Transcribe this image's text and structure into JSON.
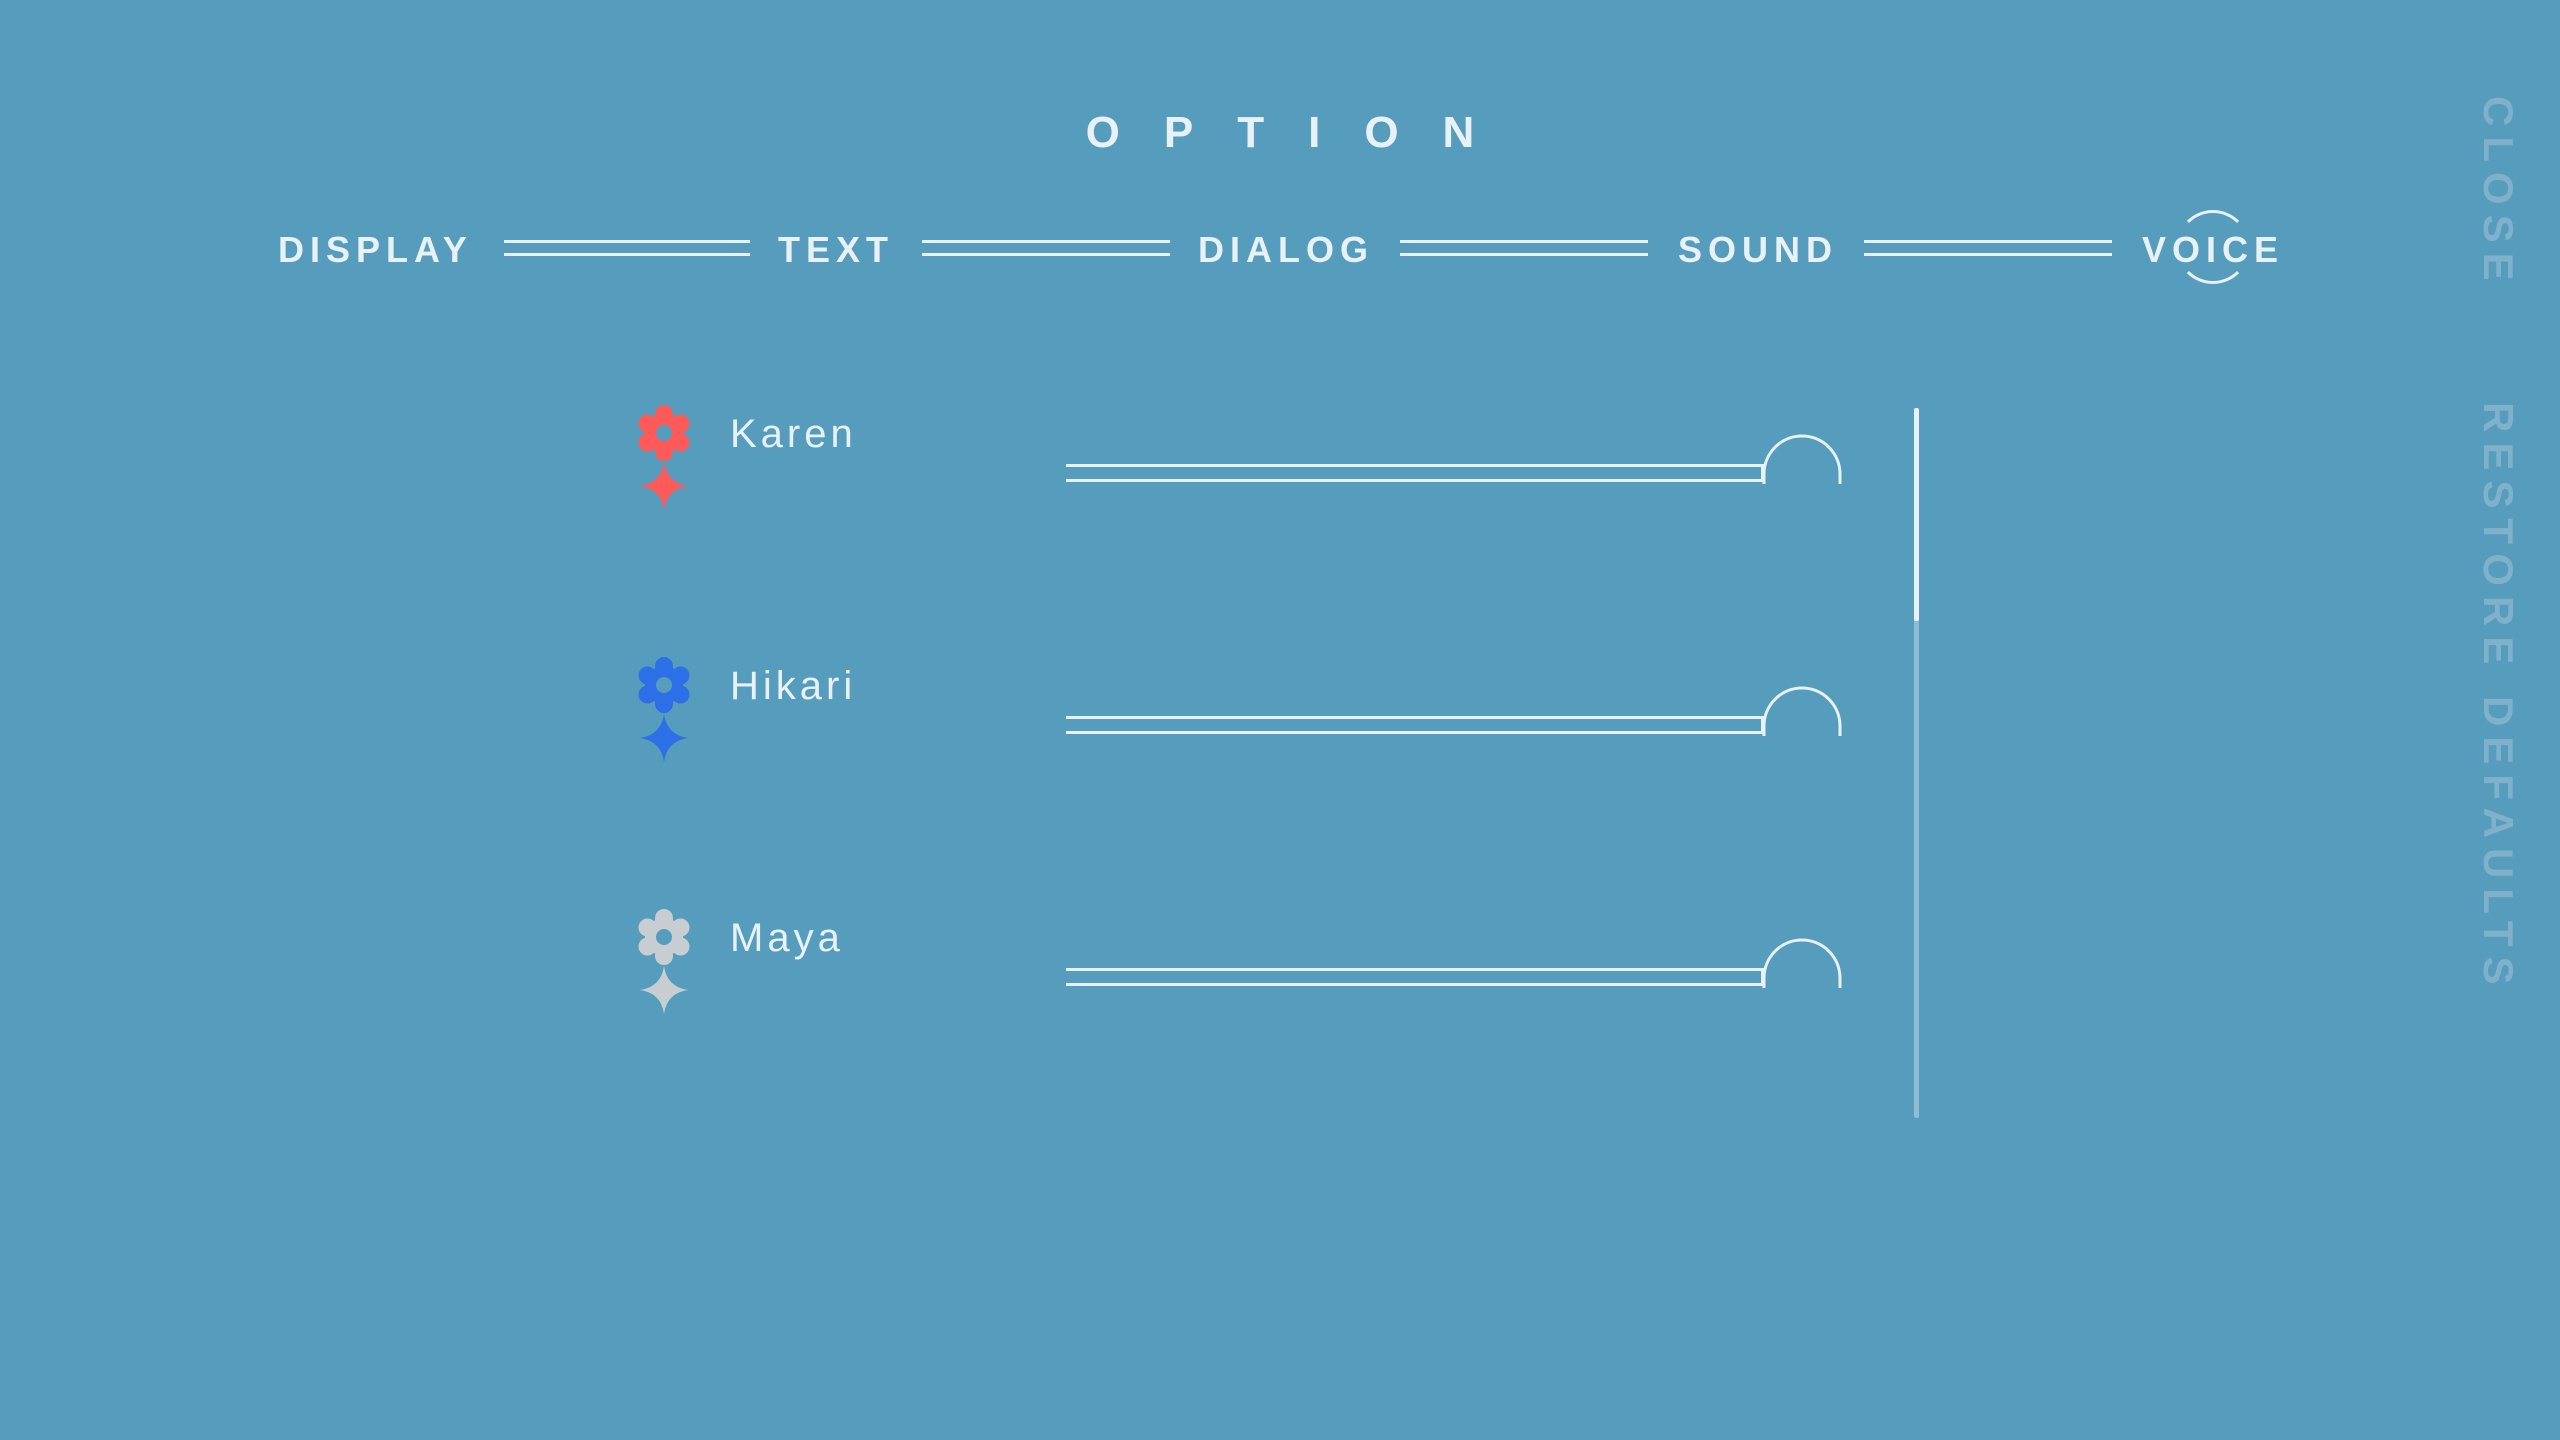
{
  "header": {
    "title": "OPTION"
  },
  "tabs": [
    {
      "label": "DISPLAY",
      "active": false
    },
    {
      "label": "TEXT",
      "active": false
    },
    {
      "label": "DIALOG",
      "active": false
    },
    {
      "label": "SOUND",
      "active": false
    },
    {
      "label": "VOICE",
      "active": true
    }
  ],
  "side_actions": {
    "close_label": "CLOSE",
    "restore_label": "RESTORE DEFAULTS"
  },
  "voices": [
    {
      "name": "Karen",
      "color": "#ff5a5a",
      "volume_fraction": 1.0
    },
    {
      "name": "Hikari",
      "color": "#2d6fe6",
      "volume_fraction": 1.0
    },
    {
      "name": "Maya",
      "color": "#c8cdd2",
      "volume_fraction": 1.0
    }
  ],
  "scroll": {
    "position_fraction": 0.0,
    "visible_fraction": 0.3
  },
  "colors": {
    "background": "#569dbd",
    "foreground": "#e8f1f6",
    "muted": "#7fb2ca"
  }
}
